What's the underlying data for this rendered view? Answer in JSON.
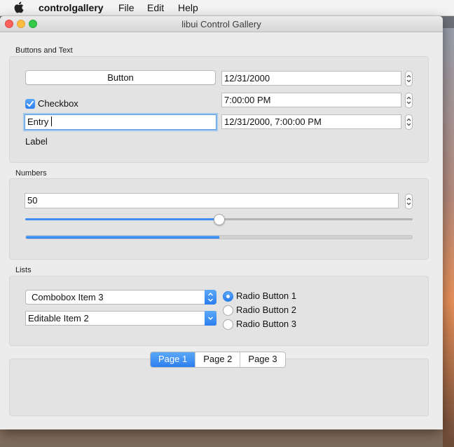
{
  "menubar": {
    "app_name": "controlgallery",
    "items": [
      "File",
      "Edit",
      "Help"
    ]
  },
  "window": {
    "title": "libui Control Gallery"
  },
  "buttons_text": {
    "group_label": "Buttons and Text",
    "button_label": "Button",
    "checkbox_label": "Checkbox",
    "checkbox_checked": true,
    "entry_value": "Entry",
    "label_text": "Label",
    "date_value": "12/31/2000",
    "time_value": " 7:00:00 PM",
    "datetime_value": "12/31/2000,   7:00:00 PM"
  },
  "numbers": {
    "group_label": "Numbers",
    "spinbox_value": "50",
    "slider_value": 50,
    "progress_value": 50
  },
  "lists": {
    "group_label": "Lists",
    "combobox_selected": "Combobox Item 3",
    "editable_combobox_value": "Editable Item 2",
    "radio_buttons": [
      {
        "label": "Radio Button 1",
        "selected": true
      },
      {
        "label": "Radio Button 2",
        "selected": false
      },
      {
        "label": "Radio Button 3",
        "selected": false
      }
    ]
  },
  "tabs": {
    "items": [
      "Page 1",
      "Page 2",
      "Page 3"
    ],
    "active_index": 0
  },
  "colors": {
    "accent": "#2d7ef0",
    "window_bg": "#ececec",
    "group_bg": "#e3e3e3"
  }
}
